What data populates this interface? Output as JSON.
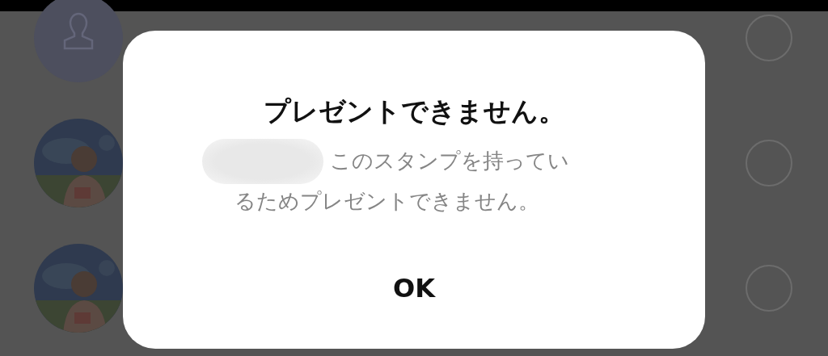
{
  "friends": [
    {
      "avatar": {
        "kind": "default"
      },
      "selected": false
    },
    {
      "selected": false
    },
    {
      "selected": false
    }
  ],
  "dialog": {
    "title": "プレゼントできません。",
    "message_lines": [
      "このスタンプを持ってい",
      "るためプレゼントできません。"
    ],
    "button": "OK"
  }
}
